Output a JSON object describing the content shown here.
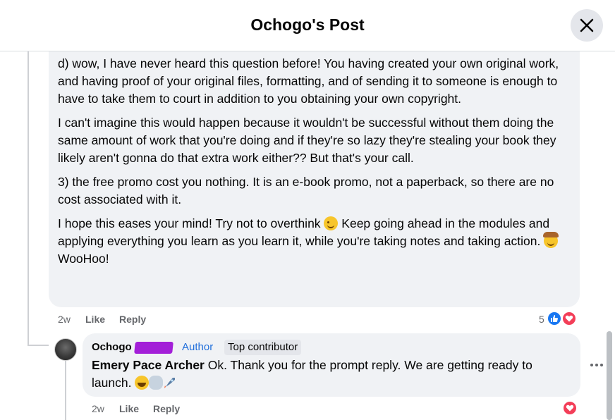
{
  "header": {
    "title": "Ochogo's Post"
  },
  "comment1": {
    "paragraphs": [
      "d) wow, I have never heard this question before! You having created your own original work, and having proof of your original files, formatting, and of sending it to someone is enough to have to take them to court in addition to you obtaining your own copyright.",
      "I can't imagine this would happen because it wouldn't be successful without them doing the same amount of work that you're doing and if they're so lazy they're stealing your book they likely aren't gonna do that extra work either?? But that's your call.",
      "3) the free promo cost you nothing. It is an e-book promo, not a paperback, so there are no cost associated with it."
    ],
    "p4_part1": "I hope this eases your mind! Try not to overthink",
    "p4_part2": " Keep going ahead in the modules and applying everything you learn as you learn it, while you're taking notes and taking action.",
    "signoff": "WooHoo!",
    "time": "2w",
    "like_label": "Like",
    "reply_label": "Reply",
    "reaction_count": "5",
    "emojis": [
      "wink-emoji",
      "cowboy-emoji"
    ]
  },
  "comment2": {
    "author": "Ochogo",
    "author_badge": "Author",
    "contributor_badge": "Top contributor",
    "mention": "Emery Pace Archer",
    "text": " Ok. Thank you for the prompt reply. We are getting ready to launch. ",
    "time": "2w",
    "like_label": "Like",
    "reply_label": "Reply",
    "emojis": [
      "grin-emoji",
      "cloud-emoji",
      "rocket-emoji"
    ]
  },
  "colors": {
    "accent": "#216fdb",
    "like_blue": "#1877f2",
    "love_red": "#f33e58",
    "bubble_bg": "#f0f2f5",
    "redaction": "#a31fd8"
  }
}
